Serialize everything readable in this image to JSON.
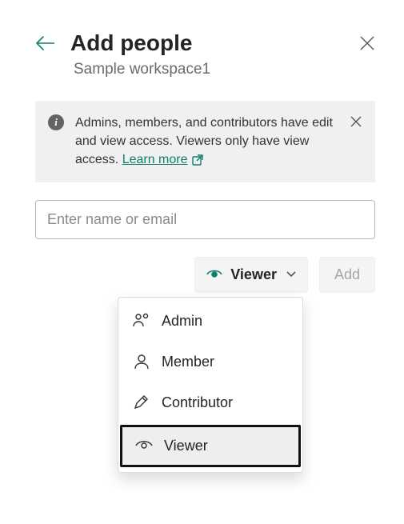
{
  "header": {
    "title": "Add people",
    "subtitle": "Sample workspace1"
  },
  "info": {
    "text": "Admins, members, and contributors have edit and view access. Viewers only have view access. ",
    "learn_more": "Learn more "
  },
  "input": {
    "placeholder": "Enter name or email"
  },
  "controls": {
    "role_selected": "Viewer",
    "add_label": "Add"
  },
  "dropdown": {
    "items": [
      {
        "label": "Admin"
      },
      {
        "label": "Member"
      },
      {
        "label": "Contributor"
      },
      {
        "label": "Viewer"
      }
    ]
  }
}
